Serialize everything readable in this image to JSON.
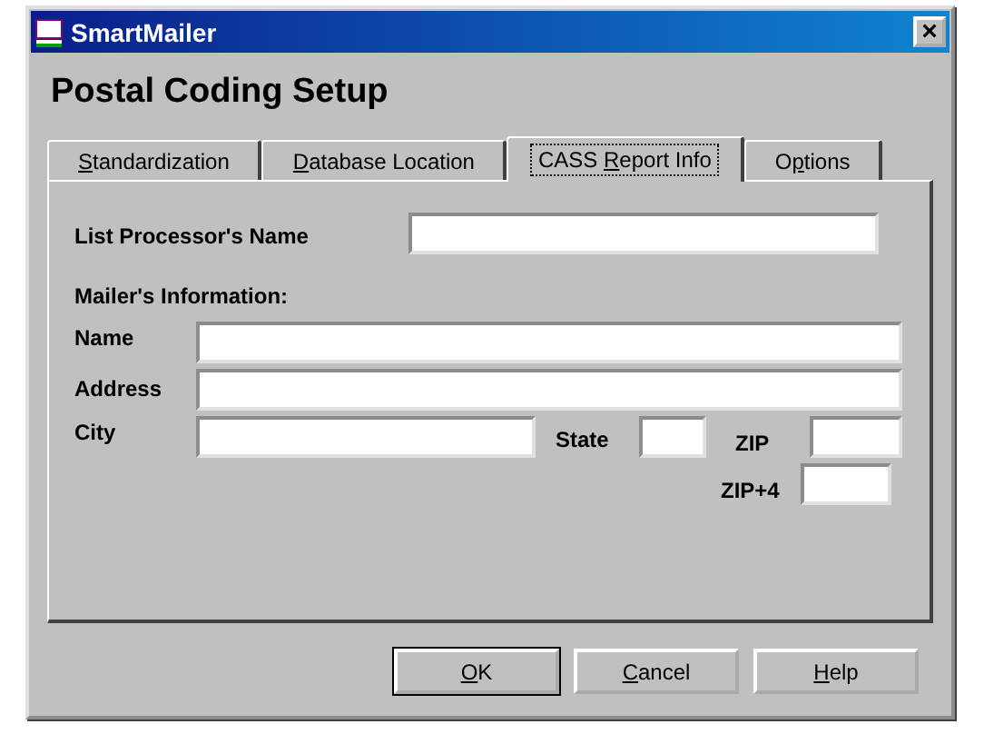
{
  "window": {
    "title": "SmartMailer",
    "close": "×"
  },
  "heading": "Postal Coding Setup",
  "tabs": [
    {
      "access_key": "S",
      "label_rest": "tandardization",
      "selected": false
    },
    {
      "access_key": "D",
      "label_rest": "atabase Location",
      "selected": false
    },
    {
      "label_start": "CASS ",
      "access_key": "R",
      "label_rest": "eport Info",
      "selected": true
    },
    {
      "label_start": "O",
      "access_key": "p",
      "label_rest": "tions",
      "selected": false
    }
  ],
  "list_processor": {
    "label": "List Processor's Name"
  },
  "mailer_section": "Mailer's Information:",
  "mailer": {
    "name": {
      "label": "Name"
    },
    "address": {
      "label": "Address"
    },
    "city": {
      "label": "City"
    },
    "state": {
      "label": "State"
    },
    "zip": {
      "label": "ZIP"
    },
    "zip4": {
      "label": "ZIP+4"
    }
  },
  "buttons": [
    {
      "access_key": "O",
      "label_rest": "K",
      "default": true
    },
    {
      "access_key": "C",
      "label_rest": "ancel",
      "default": false
    },
    {
      "access_key": "H",
      "label_rest": "elp",
      "default": false
    }
  ]
}
